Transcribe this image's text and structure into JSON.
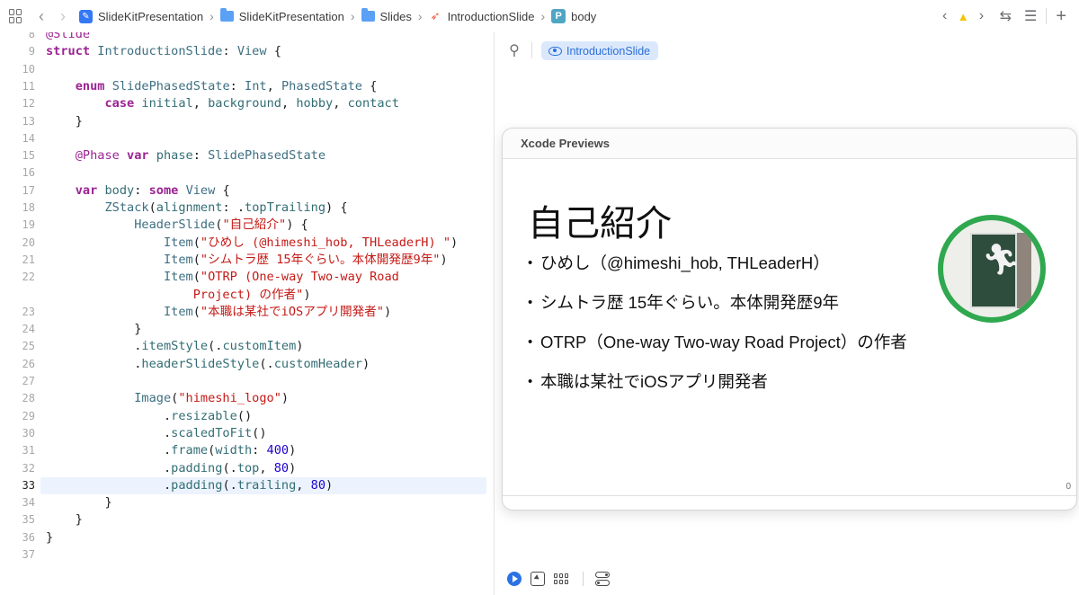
{
  "jumpbar": {
    "crumbs": [
      "SlideKitPresentation",
      "SlideKitPresentation",
      "Slides",
      "IntroductionSlide",
      "body"
    ]
  },
  "editor": {
    "lines": [
      {
        "n": "8",
        "segs": [
          [
            "k-attr",
            "@Slide"
          ]
        ]
      },
      {
        "n": "9",
        "segs": [
          [
            "k-kw",
            "struct"
          ],
          [
            "",
            " "
          ],
          [
            "k-type",
            "IntroductionSlide"
          ],
          [
            "",
            ": "
          ],
          [
            "k-type",
            "View"
          ],
          [
            "",
            " {"
          ]
        ]
      },
      {
        "n": "10",
        "segs": []
      },
      {
        "n": "11",
        "segs": [
          [
            "",
            "    "
          ],
          [
            "k-kw",
            "enum"
          ],
          [
            "",
            " "
          ],
          [
            "k-type",
            "SlidePhasedState"
          ],
          [
            "",
            ": "
          ],
          [
            "k-type",
            "Int"
          ],
          [
            "",
            ", "
          ],
          [
            "k-type",
            "PhasedState"
          ],
          [
            "",
            " {"
          ]
        ]
      },
      {
        "n": "12",
        "segs": [
          [
            "",
            "        "
          ],
          [
            "k-kw",
            "case"
          ],
          [
            "",
            " "
          ],
          [
            "k-prop",
            "initial"
          ],
          [
            "",
            ", "
          ],
          [
            "k-prop",
            "background"
          ],
          [
            "",
            ", "
          ],
          [
            "k-prop",
            "hobby"
          ],
          [
            "",
            ", "
          ],
          [
            "k-prop",
            "contact"
          ]
        ]
      },
      {
        "n": "13",
        "segs": [
          [
            "",
            "    }"
          ]
        ]
      },
      {
        "n": "14",
        "segs": []
      },
      {
        "n": "15",
        "segs": [
          [
            "",
            "    "
          ],
          [
            "k-attr",
            "@Phase"
          ],
          [
            "",
            " "
          ],
          [
            "k-kw",
            "var"
          ],
          [
            "",
            " "
          ],
          [
            "k-prop",
            "phase"
          ],
          [
            "",
            ": "
          ],
          [
            "k-type",
            "SlidePhasedState"
          ]
        ]
      },
      {
        "n": "16",
        "segs": []
      },
      {
        "n": "17",
        "segs": [
          [
            "",
            "    "
          ],
          [
            "k-kw",
            "var"
          ],
          [
            "",
            " "
          ],
          [
            "k-prop",
            "body"
          ],
          [
            "",
            ": "
          ],
          [
            "k-kw",
            "some"
          ],
          [
            "",
            " "
          ],
          [
            "k-type",
            "View"
          ],
          [
            "",
            " {"
          ]
        ]
      },
      {
        "n": "18",
        "segs": [
          [
            "",
            "        "
          ],
          [
            "k-type",
            "ZStack"
          ],
          [
            "",
            "("
          ],
          [
            "k-prop",
            "alignment"
          ],
          [
            "",
            ": ."
          ],
          [
            "k-prop",
            "topTrailing"
          ],
          [
            "",
            ") {"
          ]
        ]
      },
      {
        "n": "19",
        "segs": [
          [
            "",
            "            "
          ],
          [
            "k-type",
            "HeaderSlide"
          ],
          [
            "",
            "("
          ],
          [
            "k-str",
            "\"自己紹介\""
          ],
          [
            "",
            ") {"
          ]
        ]
      },
      {
        "n": "20",
        "segs": [
          [
            "",
            "                "
          ],
          [
            "k-type",
            "Item"
          ],
          [
            "",
            "("
          ],
          [
            "k-str",
            "\"ひめし (@himeshi_hob, THLeaderH) \""
          ],
          [
            "",
            ")"
          ]
        ]
      },
      {
        "n": "21",
        "segs": [
          [
            "",
            "                "
          ],
          [
            "k-type",
            "Item"
          ],
          [
            "",
            "("
          ],
          [
            "k-str",
            "\"シムトラ歴 15年ぐらい。本体開発歴9年\""
          ],
          [
            "",
            ")"
          ]
        ]
      },
      {
        "n": "22",
        "segs": [
          [
            "",
            "                "
          ],
          [
            "k-type",
            "Item"
          ],
          [
            "",
            "("
          ],
          [
            "k-str",
            "\"OTRP (One-way Two-way Road"
          ]
        ]
      },
      {
        "n": "",
        "segs": [
          [
            "",
            "                    "
          ],
          [
            "k-str",
            "Project) の作者\""
          ],
          [
            "",
            ")"
          ]
        ]
      },
      {
        "n": "23",
        "segs": [
          [
            "",
            "                "
          ],
          [
            "k-type",
            "Item"
          ],
          [
            "",
            "("
          ],
          [
            "k-str",
            "\"本職は某社でiOSアプリ開発者\""
          ],
          [
            "",
            ")"
          ]
        ]
      },
      {
        "n": "24",
        "segs": [
          [
            "",
            "            }"
          ]
        ]
      },
      {
        "n": "25",
        "segs": [
          [
            "",
            "            ."
          ],
          [
            "k-prop",
            "itemStyle"
          ],
          [
            "",
            "(."
          ],
          [
            "k-prop",
            "customItem"
          ],
          [
            "",
            ")"
          ]
        ]
      },
      {
        "n": "26",
        "segs": [
          [
            "",
            "            ."
          ],
          [
            "k-prop",
            "headerSlideStyle"
          ],
          [
            "",
            "(."
          ],
          [
            "k-prop",
            "customHeader"
          ],
          [
            "",
            ")"
          ]
        ]
      },
      {
        "n": "27",
        "segs": []
      },
      {
        "n": "28",
        "segs": [
          [
            "",
            "            "
          ],
          [
            "k-type",
            "Image"
          ],
          [
            "",
            "("
          ],
          [
            "k-str",
            "\"himeshi_logo\""
          ],
          [
            "",
            ")"
          ]
        ]
      },
      {
        "n": "29",
        "segs": [
          [
            "",
            "                ."
          ],
          [
            "k-prop",
            "resizable"
          ],
          [
            "",
            "()"
          ]
        ]
      },
      {
        "n": "30",
        "segs": [
          [
            "",
            "                ."
          ],
          [
            "k-prop",
            "scaledToFit"
          ],
          [
            "",
            "()"
          ]
        ]
      },
      {
        "n": "31",
        "segs": [
          [
            "",
            "                ."
          ],
          [
            "k-prop",
            "frame"
          ],
          [
            "",
            "("
          ],
          [
            "k-prop",
            "width"
          ],
          [
            "",
            ": "
          ],
          [
            "k-num",
            "400"
          ],
          [
            "",
            ")"
          ]
        ]
      },
      {
        "n": "32",
        "segs": [
          [
            "",
            "                ."
          ],
          [
            "k-prop",
            "padding"
          ],
          [
            "",
            "(."
          ],
          [
            "k-prop",
            "top"
          ],
          [
            "",
            ", "
          ],
          [
            "k-num",
            "80"
          ],
          [
            "",
            ")"
          ]
        ]
      },
      {
        "n": "33",
        "segs": [
          [
            "",
            "                ."
          ],
          [
            "k-prop",
            "padding"
          ],
          [
            "",
            "(."
          ],
          [
            "k-prop",
            "trailing"
          ],
          [
            "",
            ", "
          ],
          [
            "k-num",
            "80"
          ],
          [
            "",
            ")"
          ]
        ],
        "current": true
      },
      {
        "n": "34",
        "segs": [
          [
            "",
            "        }"
          ]
        ]
      },
      {
        "n": "35",
        "segs": [
          [
            "",
            "    }"
          ]
        ]
      },
      {
        "n": "36",
        "segs": [
          [
            "",
            "}"
          ]
        ]
      },
      {
        "n": "37",
        "segs": []
      }
    ]
  },
  "canvas": {
    "chip_label": "IntroductionSlide",
    "preview_title": "Xcode Previews",
    "slide_title": "自己紹介",
    "bullets": [
      "ひめし（@himeshi_hob, THLeaderH）",
      "シムトラ歴 15年ぐらい。本体開発歴9年",
      "OTRP（One-way Two-way Road Project）の作者",
      "本職は某社でiOSアプリ開発者"
    ],
    "corner_value": "0"
  },
  "icons": {
    "grid": "grid-icon",
    "back": "chevron-left-icon",
    "forward": "chevron-right-icon",
    "warning": "warning-icon",
    "pin": "pin-icon",
    "eye": "eye-icon",
    "logo": "emergency-exit-logo"
  },
  "colors": {
    "accent": "#2a72e5",
    "chip_bg": "#dbe8fc",
    "logo_ring": "#2fa84f",
    "warning": "#f5c400"
  }
}
